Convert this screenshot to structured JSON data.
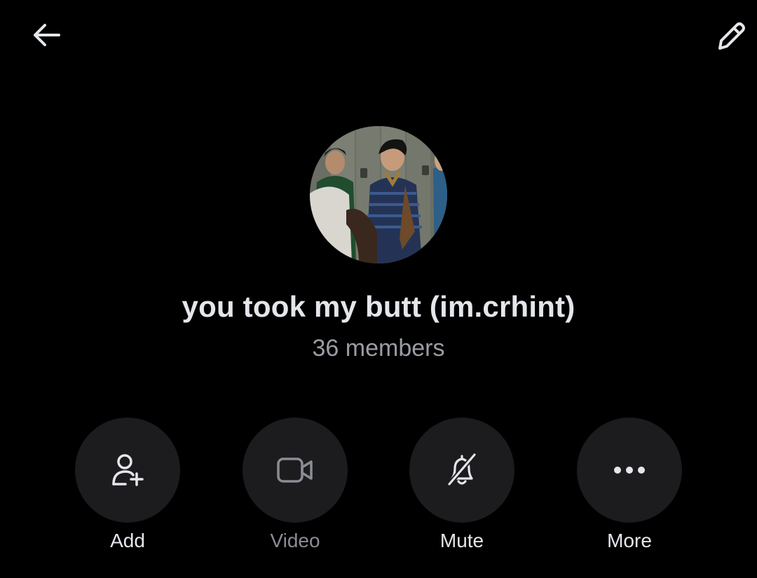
{
  "header": {
    "back_icon": "arrow-left-icon",
    "edit_icon": "pencil-icon"
  },
  "group": {
    "avatar": "group-photo",
    "title": "you took my butt (im.crhint)",
    "members": "36 members"
  },
  "actions": [
    {
      "label": "Add",
      "icon": "add-person-icon",
      "enabled": true
    },
    {
      "label": "Video",
      "icon": "video-camera-icon",
      "enabled": false
    },
    {
      "label": "Mute",
      "icon": "bell-off-icon",
      "enabled": true
    },
    {
      "label": "More",
      "icon": "more-dots-icon",
      "enabled": true
    }
  ],
  "colors": {
    "background": "#000000",
    "button_circle": "#1c1c1e",
    "primary_text": "#e4e6eb",
    "secondary_text": "#9a9da3",
    "disabled_icon": "#8a8d93"
  }
}
